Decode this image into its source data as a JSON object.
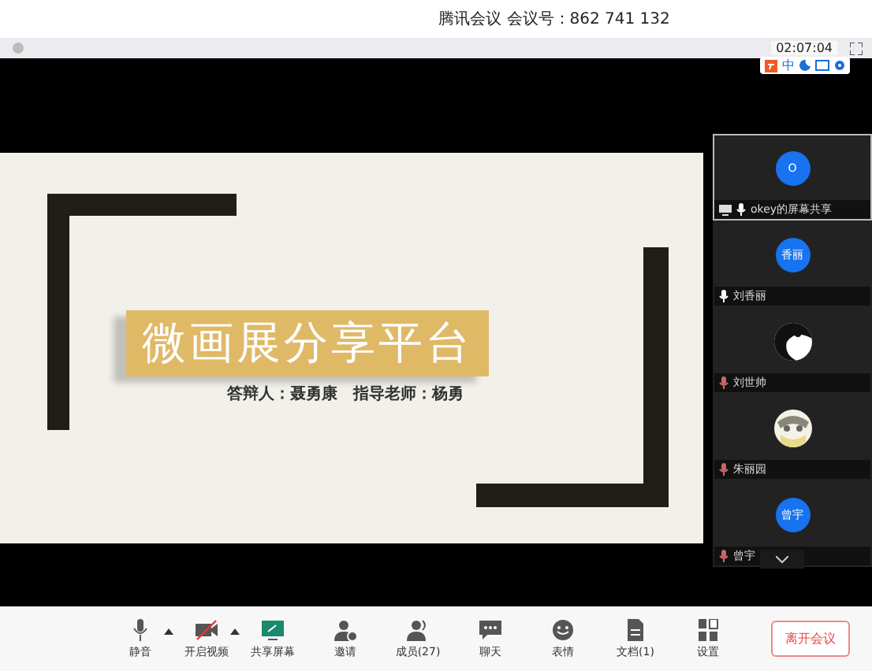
{
  "window": {
    "title": "腾讯会议 会议号：862 741 132"
  },
  "timer": "02:07:04",
  "ime_bar": {
    "label": "中"
  },
  "slide": {
    "title": "微画展分享平台",
    "subtitle": "答辩人：聂勇康　指导老师：杨勇"
  },
  "participants": [
    {
      "kind": "initials",
      "avatar": "O",
      "label": "okey的屏幕共享",
      "selected": true,
      "muted": false,
      "sharing": true
    },
    {
      "kind": "initials",
      "avatar": "香丽",
      "label": "刘香丽",
      "selected": false,
      "muted": false,
      "sharing": false
    },
    {
      "kind": "picture",
      "label": "刘世帅",
      "selected": false,
      "muted": true,
      "sharing": false
    },
    {
      "kind": "picture",
      "label": "朱丽园",
      "selected": false,
      "muted": true,
      "sharing": false
    },
    {
      "kind": "initials",
      "avatar": "曾宇",
      "label": "曾宇",
      "selected": false,
      "muted": true,
      "sharing": false
    }
  ],
  "toolbar": [
    {
      "kind": "mic",
      "label": "静音",
      "menu": true
    },
    {
      "kind": "video",
      "label": "开启视频",
      "menu": true
    },
    {
      "kind": "share",
      "label": "共享屏幕",
      "menu": false
    },
    {
      "kind": "invite",
      "label": "邀请",
      "menu": false
    },
    {
      "kind": "members",
      "label": "成员(27)",
      "menu": false
    },
    {
      "kind": "chat",
      "label": "聊天",
      "menu": false
    },
    {
      "kind": "emoji",
      "label": "表情",
      "menu": false
    },
    {
      "kind": "doc",
      "label": "文档(1)",
      "menu": false
    },
    {
      "kind": "settings",
      "label": "设置",
      "menu": false
    }
  ],
  "leave_button": "离开会议"
}
